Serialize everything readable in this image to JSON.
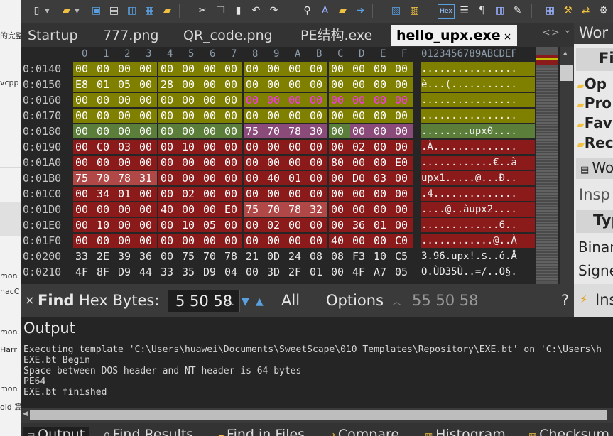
{
  "left_app": {
    "fragments": [
      "的完整",
      "vcpp",
      "mon",
      "nacC",
      "mon",
      "Harr",
      "mon",
      "oid 篇"
    ]
  },
  "toolbar": {
    "icons": [
      "new-file-icon",
      "open-folder-icon",
      "save-icon",
      "save-all-icon",
      "copy-file-icon",
      "folder-icon",
      "cut-icon",
      "copy-icon",
      "paste-icon",
      "undo-icon",
      "redo-icon",
      "find-icon",
      "replace-icon",
      "find-in-files-icon",
      "goto-icon",
      "template-icon",
      "script-icon",
      "hex-mode-icon",
      "text-mode-icon",
      "paragraph-icon",
      "columns-icon",
      "highlight-icon",
      "calculator-icon",
      "tools-icon",
      "compare-icon",
      "settings-icon"
    ],
    "hex_label": "Hex"
  },
  "tabs": {
    "items": [
      "Startup",
      "777.png",
      "QR_code.png",
      "PE结构.exe",
      "hello_upx.exe"
    ],
    "active_index": 4,
    "close_symbol": "×",
    "nav_prev": "<",
    "nav_next": ">",
    "menu": "⌄"
  },
  "hex": {
    "columns": [
      "0",
      "1",
      "2",
      "3",
      "4",
      "5",
      "6",
      "7",
      "8",
      "9",
      "A",
      "B",
      "C",
      "D",
      "E",
      "F"
    ],
    "ascii_header": "0123456789ABCDEF",
    "rows": [
      {
        "addr": "0:0140",
        "bytes": [
          "00",
          "00",
          "00",
          "00",
          "00",
          "00",
          "00",
          "00",
          "00",
          "00",
          "00",
          "00",
          "00",
          "00",
          "00",
          "00"
        ],
        "ascii": "................"
      },
      {
        "addr": "0:0150",
        "bytes": [
          "E8",
          "01",
          "05",
          "00",
          "28",
          "00",
          "00",
          "00",
          "00",
          "00",
          "00",
          "00",
          "00",
          "00",
          "00",
          "00"
        ],
        "ascii": "è...(..........."
      },
      {
        "addr": "0:0160",
        "bytes": [
          "00",
          "00",
          "00",
          "00",
          "00",
          "00",
          "00",
          "00",
          "00",
          "00",
          "00",
          "00",
          "00",
          "00",
          "00",
          "00"
        ],
        "ascii": "................"
      },
      {
        "addr": "0:0170",
        "bytes": [
          "00",
          "00",
          "00",
          "00",
          "00",
          "00",
          "00",
          "00",
          "00",
          "00",
          "00",
          "00",
          "00",
          "00",
          "00",
          "00"
        ],
        "ascii": "................"
      },
      {
        "addr": "0:0180",
        "bytes": [
          "00",
          "00",
          "00",
          "00",
          "00",
          "00",
          "00",
          "00",
          "75",
          "70",
          "78",
          "30",
          "00",
          "00",
          "00",
          "00"
        ],
        "ascii": "........upx0...."
      },
      {
        "addr": "0:0190",
        "bytes": [
          "00",
          "C0",
          "03",
          "00",
          "00",
          "10",
          "00",
          "00",
          "00",
          "00",
          "00",
          "00",
          "00",
          "02",
          "00",
          "00"
        ],
        "ascii": ".À.............."
      },
      {
        "addr": "0:01A0",
        "bytes": [
          "00",
          "00",
          "00",
          "00",
          "00",
          "00",
          "00",
          "00",
          "00",
          "00",
          "00",
          "00",
          "80",
          "00",
          "00",
          "E0"
        ],
        "ascii": "............€..à"
      },
      {
        "addr": "0:01B0",
        "bytes": [
          "75",
          "70",
          "78",
          "31",
          "00",
          "00",
          "00",
          "00",
          "00",
          "40",
          "01",
          "00",
          "00",
          "D0",
          "03",
          "00"
        ],
        "ascii": "upx1.....@...Ð.."
      },
      {
        "addr": "0:01C0",
        "bytes": [
          "00",
          "34",
          "01",
          "00",
          "00",
          "02",
          "00",
          "00",
          "00",
          "00",
          "00",
          "00",
          "00",
          "00",
          "00",
          "00"
        ],
        "ascii": ".4.............."
      },
      {
        "addr": "0:01D0",
        "bytes": [
          "00",
          "00",
          "00",
          "00",
          "40",
          "00",
          "00",
          "E0",
          "75",
          "70",
          "78",
          "32",
          "00",
          "00",
          "00",
          "00"
        ],
        "ascii": "....@..àupx2...."
      },
      {
        "addr": "0:01E0",
        "bytes": [
          "00",
          "10",
          "00",
          "00",
          "00",
          "10",
          "05",
          "00",
          "00",
          "02",
          "00",
          "00",
          "00",
          "36",
          "01",
          "00"
        ],
        "ascii": ".............6.."
      },
      {
        "addr": "0:01F0",
        "bytes": [
          "00",
          "00",
          "00",
          "00",
          "00",
          "00",
          "00",
          "00",
          "00",
          "00",
          "00",
          "00",
          "40",
          "00",
          "00",
          "C0"
        ],
        "ascii": "............@..À"
      },
      {
        "addr": "0:0200",
        "bytes": [
          "33",
          "2E",
          "39",
          "36",
          "00",
          "75",
          "70",
          "78",
          "21",
          "0D",
          "24",
          "08",
          "08",
          "F3",
          "10",
          "C5"
        ],
        "ascii": "3.96.upx!.$..ó.Å"
      },
      {
        "addr": "0:0210",
        "bytes": [
          "4F",
          "8F",
          "D9",
          "44",
          "33",
          "35",
          "D9",
          "04",
          "00",
          "3D",
          "2F",
          "01",
          "00",
          "4F",
          "A7",
          "05"
        ],
        "ascii": "O.ÙD35Ù..=/..O§."
      }
    ]
  },
  "colors": {
    "olive": "#808000",
    "green": "#5b7f3a",
    "pink": "#8a4a7a",
    "red": "#8b1a1a",
    "salmon": "#b04848",
    "magenta_text": "#ff30ff",
    "plain_text": "#ffffff",
    "data_text": "#e8e8e8"
  },
  "right_panel": {
    "items": [
      "Wor",
      "Fil",
      "Op",
      "Pro",
      "Fav",
      "Rec",
      "Wo",
      "Insp",
      "Typ",
      "Binar",
      "Signe"
    ]
  },
  "find": {
    "close": "×",
    "label": "Find",
    "mode": "Hex Bytes:",
    "value": "5 50 58",
    "all": "All",
    "options": "Options",
    "result": "55 50 58",
    "help": "?",
    "inspector": "Ins"
  },
  "output": {
    "title": "Output",
    "lines": [
      "Executing template 'C:\\Users\\huawei\\Documents\\SweetScape\\010 Templates\\Repository\\EXE.bt' on 'C:\\Users\\h",
      "EXE.bt Begin",
      "Space between DOS header and NT header is 64 bytes",
      "PE64",
      "EXE.bt finished"
    ]
  },
  "bottom_tabs": {
    "items": [
      "Output",
      "Find Results",
      "Find in Files",
      "Compare",
      "Histogram",
      "Checksum"
    ]
  }
}
